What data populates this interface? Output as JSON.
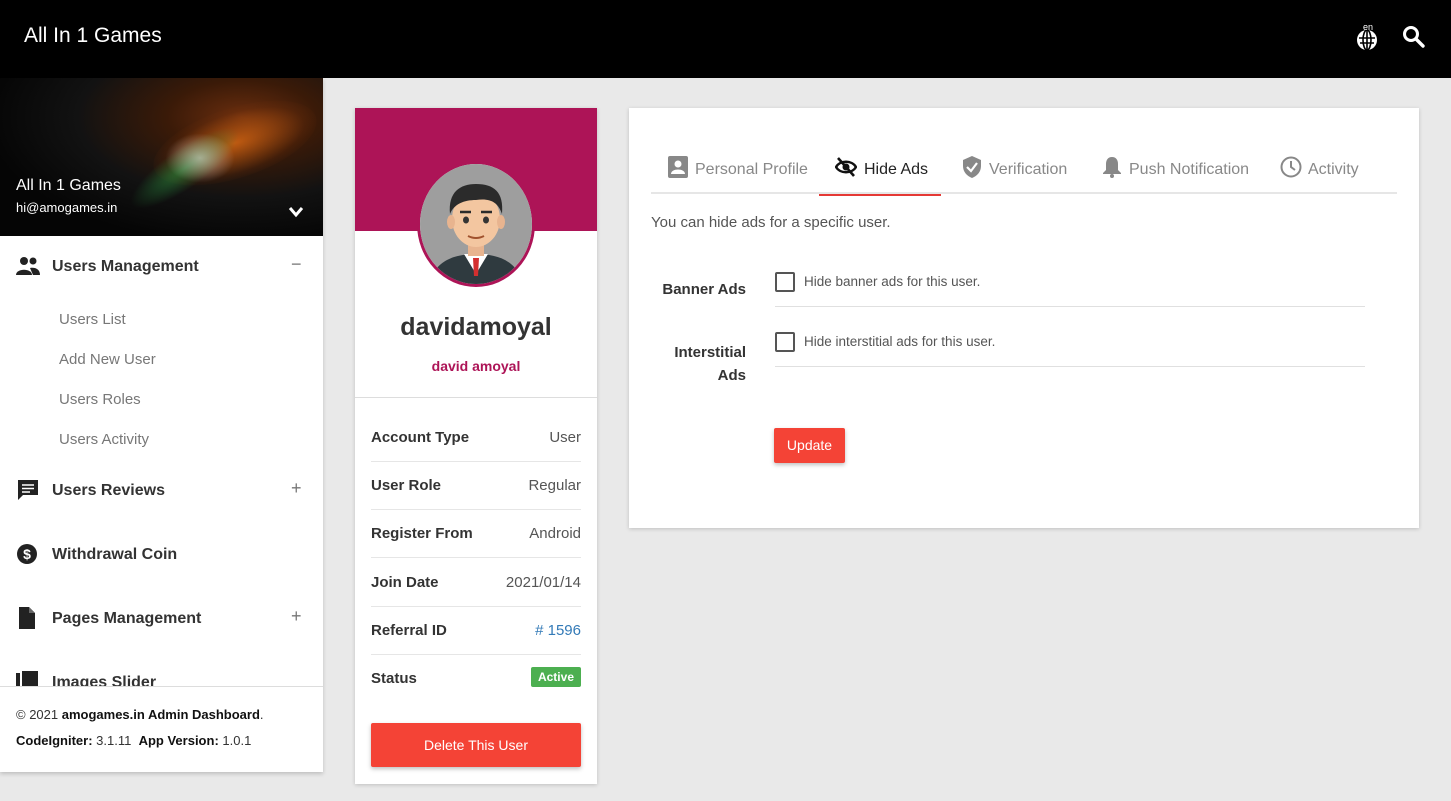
{
  "topbar": {
    "app_title": "All In 1 Games",
    "language_code": "en",
    "icons": [
      "language-icon",
      "search-icon"
    ]
  },
  "sidebar": {
    "title": "All In 1 Games",
    "email": "hi@amogames.in",
    "menu": [
      {
        "label": "Users Management",
        "icon": "people-icon",
        "toggle": "−"
      },
      {
        "label": "Users Reviews",
        "icon": "comment-icon",
        "toggle": "+"
      },
      {
        "label": "Withdrawal Coin",
        "icon": "dollar-icon",
        "toggle": ""
      },
      {
        "label": "Pages Management",
        "icon": "page-icon",
        "toggle": "+"
      },
      {
        "label": "Images Slider",
        "icon": "image-icon",
        "toggle": ""
      }
    ],
    "submenu": [
      "Users List",
      "Add New User",
      "Users Roles",
      "Users Activity"
    ],
    "footer": {
      "copyright_prefix": "© 2021 ",
      "brand": "amogames.in Admin Dashboard",
      "period": ".",
      "framework_label": "CodeIgniter:",
      "framework_version": " 3.1.11",
      "app_version_label": "App Version:",
      "app_version": " 1.0.1"
    }
  },
  "profile": {
    "username": "davidamoyal",
    "full_name": "david amoyal",
    "rows": [
      {
        "key": "Account Type",
        "value": "User"
      },
      {
        "key": "User Role",
        "value": "Regular"
      },
      {
        "key": "Register From",
        "value": "Android"
      },
      {
        "key": "Join Date",
        "value": "2021/01/14"
      },
      {
        "key": "Referral ID",
        "value": "# 1596"
      },
      {
        "key": "Status",
        "value": "Active"
      }
    ],
    "delete_label": "Delete This User"
  },
  "main": {
    "tabs": [
      {
        "label": "Personal Profile",
        "icon": "contact-icon"
      },
      {
        "label": "Hide Ads",
        "icon": "eye-off-icon"
      },
      {
        "label": "Verification",
        "icon": "verified-shield-icon"
      },
      {
        "label": "Push Notification",
        "icon": "bell-icon"
      },
      {
        "label": "Activity",
        "icon": "clock-icon"
      }
    ],
    "active_tab": "Hide Ads",
    "intro": "You can hide ads for a specific user.",
    "banner_label": "Banner Ads",
    "banner_checkbox": "Hide banner ads for this user.",
    "interstitial_label_1": "Interstitial",
    "interstitial_label_2": "Ads",
    "interstitial_checkbox": "Hide interstitial ads for this user.",
    "update_label": "Update"
  },
  "colors": {
    "topbar": "#000000",
    "accent_magenta": "#ad1457",
    "button_red": "#f44336",
    "active_badge": "#4caf50",
    "link_blue": "#337ab7",
    "background": "#e9e9e9"
  }
}
